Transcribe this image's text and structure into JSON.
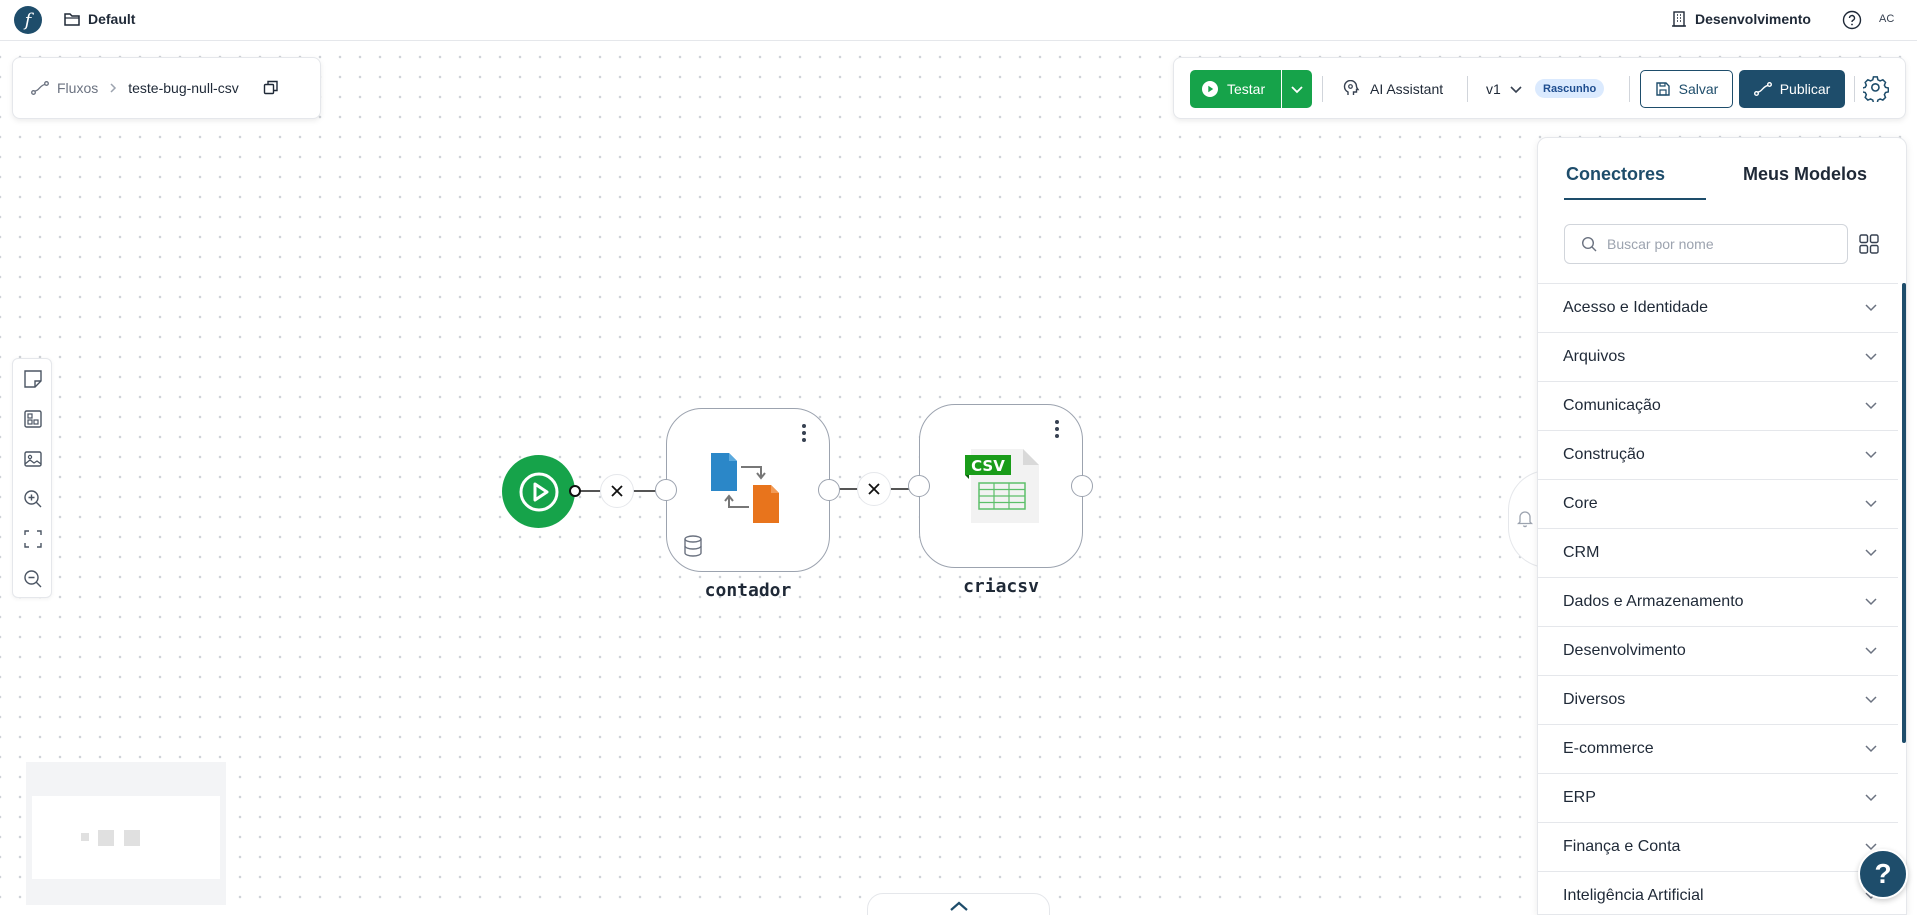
{
  "topbar": {
    "project_name": "Default",
    "environment": "Desenvolvimento",
    "user_initials": "AC"
  },
  "breadcrumb": {
    "root": "Fluxos",
    "flow_name": "teste-bug-null-csv"
  },
  "toolbar": {
    "test_label": "Testar",
    "ai_label": "AI Assistant",
    "version": "v1",
    "status_badge": "Rascunho",
    "save_label": "Salvar",
    "publish_label": "Publicar"
  },
  "flow": {
    "nodes": [
      {
        "label": "contador",
        "icon": "file-transfer-icon"
      },
      {
        "label": "criacsv",
        "icon": "csv-file-icon",
        "badge": "CSV"
      }
    ]
  },
  "panel": {
    "tabs": [
      "Conectores",
      "Meus Modelos"
    ],
    "search_placeholder": "Buscar por nome",
    "categories": [
      "Acesso e Identidade",
      "Arquivos",
      "Comunicação",
      "Construção",
      "Core",
      "CRM",
      "Dados e Armazenamento",
      "Desenvolvimento",
      "Diversos",
      "E-commerce",
      "ERP",
      "Finança e Conta",
      "Inteligência Artificial"
    ]
  },
  "help_label": "?",
  "colors": {
    "brand": "#1e4d6b",
    "success": "#16a34a",
    "badge_bg": "#dbeafe"
  }
}
